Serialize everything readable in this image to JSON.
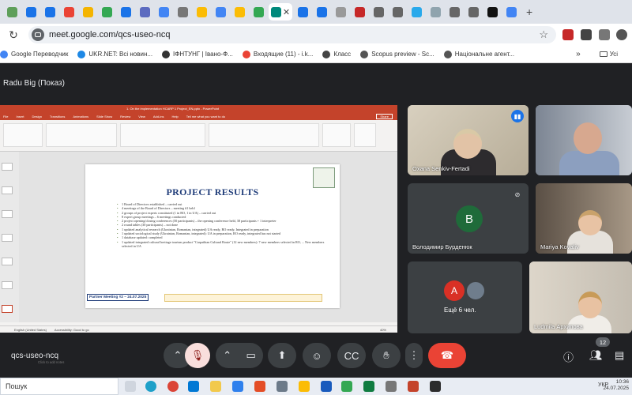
{
  "browser": {
    "url": "meet.google.com/qcs-useo-ncq",
    "bookmarks": [
      {
        "label": "Google Переводчик",
        "color": "#4285f4"
      },
      {
        "label": "UKR.NET: Всі новин...",
        "color": "#1e88e5"
      },
      {
        "label": "ІФНТУНГ | Івано-Ф...",
        "color": "#333333"
      },
      {
        "label": "Входящие (11) - i.k...",
        "color": "#ea4335"
      },
      {
        "label": "Класс",
        "color": "#444444"
      },
      {
        "label": "Scopus preview - Sc...",
        "color": "#555555"
      },
      {
        "label": "Національне агент...",
        "color": "#555555"
      }
    ],
    "bookmarks_more": "»",
    "other_bookmarks": "Усі"
  },
  "meet": {
    "presenter_label": "Radu Big (Показ)",
    "meeting_code": "qcs-useo-ncq",
    "participant_count": "12",
    "more_people": "Ещё 6 чел.",
    "participants": [
      {
        "name": "Oxana Senkiv-Fertadi",
        "state": "speaking"
      },
      {
        "name": "",
        "state": "video"
      },
      {
        "name": "Володимир Бурденюк",
        "state": "muted",
        "initial": "B"
      },
      {
        "name": "Mariya Kovaliv",
        "state": "video"
      },
      {
        "name": "Ludmila Архипова",
        "state": "video"
      }
    ],
    "accent_colors": {
      "end_call": "#ea4335",
      "speaking": "#1a73e8",
      "mic_off_bg": "#f9dedc"
    }
  },
  "powerpoint": {
    "titlebar": "1. On the implementation HCARP 1 Project_EN.pptx  -  PowerPoint",
    "menu": [
      "File",
      "Insert",
      "Design",
      "Transitions",
      "Animations",
      "Slide Show",
      "Review",
      "View",
      "Add-ins",
      "Help",
      "Tell me what you want to do"
    ],
    "share": "Share",
    "status_left": "English (United States)",
    "status_accessibility": "Accessibility: Good to go",
    "notes_placeholder": "Click to add notes",
    "zoom": "40%",
    "slide": {
      "title": "PROJECT RESULTS",
      "bullets": [
        "1 Board of Directors established – carried out",
        "4 meetings of the Board of Directors – meeting #1 held",
        "2 groups of project experts constituted (1 in RO, 1 in UA) – carried out",
        "8 expert group meetings – 6 meetings conducted",
        "2 project opening/closing conferences (50 participants) – the opening conference held, 38 participants + 1 interpreter",
        "2 round tables (30 participants) – not done",
        "1 updated analytical research (Ukrainian, Romanian, integrated) UA ready, RO ready, Integrated in preparation",
        "1 updated sociological study (Ukrainian, Romanian, integrated): UA in preparation, RO ready, integrated has not started",
        "1 database updated: completed",
        "1 updated integrated cultural heritage tourism product \"Carpathian Cultural Route\" (12 new members): 7 new members selected in RO, ... New members selected in UA"
      ],
      "footer": "Partner Meeting #2 – 24.07.2025"
    }
  },
  "taskbar": {
    "search_label": "Пошук",
    "lang": "УКР",
    "time": "10:36",
    "date": "24.07.2025"
  }
}
